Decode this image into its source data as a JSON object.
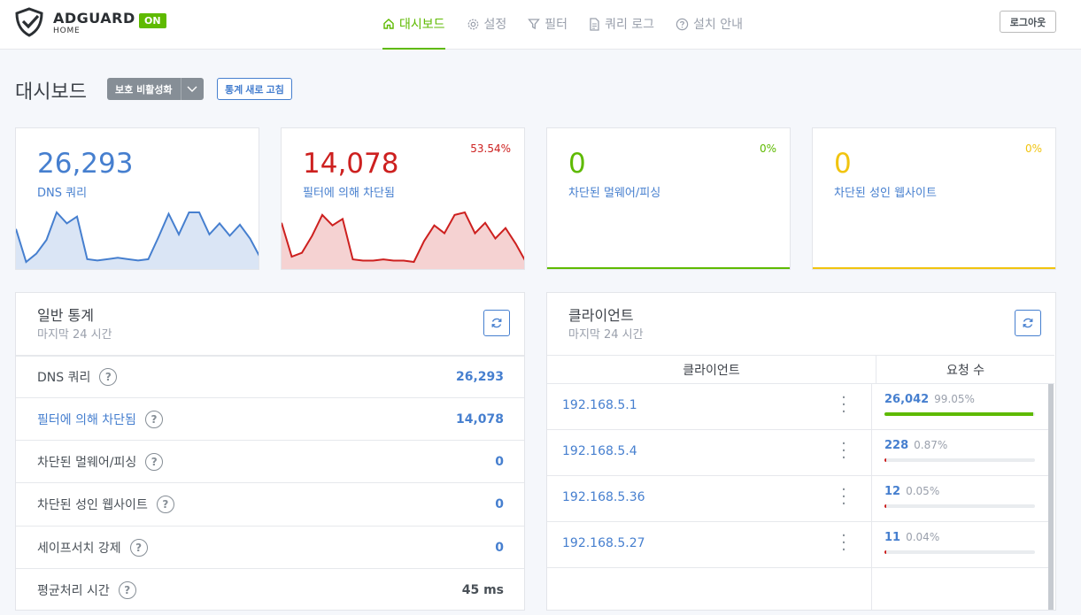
{
  "brand": {
    "name": "ADGUARD",
    "sub": "HOME",
    "status": "ON"
  },
  "nav": [
    {
      "label": "대시보드",
      "icon": "home-icon",
      "active": true
    },
    {
      "label": "설정",
      "icon": "gear-icon"
    },
    {
      "label": "필터",
      "icon": "filter-icon"
    },
    {
      "label": "쿼리 로그",
      "icon": "document-icon"
    },
    {
      "label": "설치 안내",
      "icon": "help-circle-icon"
    }
  ],
  "logout_label": "로그아웃",
  "page": {
    "title": "대시보드",
    "protect_button": "보호 비활성화",
    "refresh_stats_button": "통계 새로 고침"
  },
  "cards": {
    "dns": {
      "value": "26,293",
      "label": "DNS 쿼리"
    },
    "blocked": {
      "value": "14,078",
      "label": "필터에 의해 차단됨",
      "pct": "53.54%"
    },
    "malware": {
      "value": "0",
      "label": "차단된 멀웨어/피싱",
      "pct": "0%"
    },
    "adult": {
      "value": "0",
      "label": "차단된 성인 웹사이트",
      "pct": "0%"
    }
  },
  "chart_data": [
    {
      "type": "area",
      "series_color": "#467fcf",
      "values": [
        24,
        0,
        6,
        16,
        36,
        28,
        33,
        2,
        1,
        2,
        3,
        2,
        1,
        2,
        18,
        35,
        20,
        36,
        36,
        20,
        28,
        19,
        27,
        17,
        3
      ]
    },
    {
      "type": "area",
      "series_color": "#cd201f",
      "values": [
        30,
        4,
        7,
        20,
        36,
        28,
        33,
        2,
        1,
        1,
        2,
        1,
        1,
        0,
        16,
        28,
        22,
        36,
        38,
        22,
        30,
        18,
        26,
        14,
        0
      ]
    }
  ],
  "general_stats": {
    "title": "일반 통계",
    "subtitle": "마지막 24 시간",
    "rows": [
      {
        "label": "DNS 쿼리",
        "value": "26,293",
        "link": false
      },
      {
        "label": "필터에 의해 차단됨",
        "value": "14,078",
        "link": true
      },
      {
        "label": "차단된 멀웨어/피싱",
        "value": "0",
        "link": false
      },
      {
        "label": "차단된 성인 웹사이트",
        "value": "0",
        "link": false
      },
      {
        "label": "세이프서치 강제",
        "value": "0",
        "link": false
      },
      {
        "label": "평균처리 시간",
        "value": "45 ms",
        "link": false
      }
    ]
  },
  "clients": {
    "title": "클라이언트",
    "subtitle": "마지막 24 시간",
    "col_client": "클라이언트",
    "col_requests": "요청 수",
    "rows": [
      {
        "ip": "192.168.5.1",
        "count": "26,042",
        "pct": "99.05%",
        "fill": 99.05,
        "bar_color": "#5eba00"
      },
      {
        "ip": "192.168.5.4",
        "count": "228",
        "pct": "0.87%",
        "fill": 0.87,
        "bar_color": "#cd201f"
      },
      {
        "ip": "192.168.5.36",
        "count": "12",
        "pct": "0.05%",
        "fill": 0.05,
        "bar_color": "#cd201f"
      },
      {
        "ip": "192.168.5.27",
        "count": "11",
        "pct": "0.04%",
        "fill": 0.04,
        "bar_color": "#cd201f"
      }
    ]
  }
}
